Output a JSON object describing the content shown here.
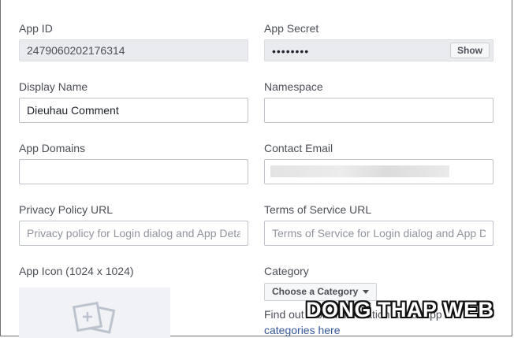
{
  "labels": {
    "app_id": "App ID",
    "app_secret": "App Secret",
    "display_name": "Display Name",
    "namespace": "Namespace",
    "app_domains": "App Domains",
    "contact_email": "Contact Email",
    "privacy_policy_url": "Privacy Policy URL",
    "terms_of_service_url": "Terms of Service URL",
    "app_icon": "App Icon (1024 x 1024)",
    "category": "Category"
  },
  "fields": {
    "app_id_value": "2479060202176314",
    "app_secret_masked": "••••••••",
    "display_name_value": "Dieuhau Comment",
    "namespace_value": "",
    "app_domains_value": "",
    "privacy_policy_placeholder": "Privacy policy for Login dialog and App Details",
    "terms_of_service_placeholder": "Terms of Service for Login dialog and App Details"
  },
  "buttons": {
    "show_secret": "Show",
    "choose_category": "Choose a Category"
  },
  "category_help": {
    "prefix": "Find out more information about app",
    "link": "categories here"
  },
  "watermark": "DONG THAP WEB",
  "icons": {
    "app_icon_placeholder": "add-image-icon",
    "category_dropdown": "caret-down-icon"
  },
  "colors": {
    "link": "#365899",
    "label": "#4b4f56",
    "readonly_bg": "#e9ebee"
  }
}
